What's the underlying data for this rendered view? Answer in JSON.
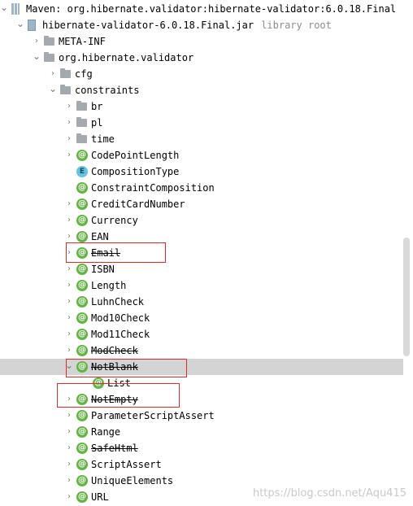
{
  "tree": {
    "rows": [
      {
        "label": "Maven: org.hibernate.validator:hibernate-validator:6.0.18.Final",
        "hint": "",
        "kind": "lib",
        "expanded": true,
        "strike": false,
        "icon": "library-icon"
      },
      {
        "label": "hibernate-validator-6.0.18.Final.jar",
        "hint": "library root",
        "kind": "jar",
        "expanded": true,
        "strike": false,
        "icon": "jar-icon"
      },
      {
        "label": "META-INF",
        "hint": "",
        "kind": "folder",
        "expanded": false,
        "strike": false,
        "icon": "folder-icon"
      },
      {
        "label": "org.hibernate.validator",
        "hint": "",
        "kind": "folder",
        "expanded": true,
        "strike": false,
        "icon": "folder-icon"
      },
      {
        "label": "cfg",
        "hint": "",
        "kind": "folder",
        "expanded": false,
        "strike": false,
        "icon": "folder-icon"
      },
      {
        "label": "constraints",
        "hint": "",
        "kind": "folder",
        "expanded": true,
        "strike": false,
        "icon": "folder-icon"
      },
      {
        "label": "br",
        "hint": "",
        "kind": "folder",
        "expanded": false,
        "strike": false,
        "icon": "folder-icon"
      },
      {
        "label": "pl",
        "hint": "",
        "kind": "folder",
        "expanded": false,
        "strike": false,
        "icon": "folder-icon"
      },
      {
        "label": "time",
        "hint": "",
        "kind": "folder",
        "expanded": false,
        "strike": false,
        "icon": "folder-icon"
      },
      {
        "label": "CodePointLength",
        "hint": "",
        "kind": "annotation",
        "expanded": false,
        "strike": false,
        "icon": "annotation-icon"
      },
      {
        "label": "CompositionType",
        "hint": "",
        "kind": "enum",
        "expanded": null,
        "strike": false,
        "icon": "enum-icon"
      },
      {
        "label": "ConstraintComposition",
        "hint": "",
        "kind": "annotation",
        "expanded": null,
        "strike": false,
        "icon": "annotation-icon"
      },
      {
        "label": "CreditCardNumber",
        "hint": "",
        "kind": "annotation",
        "expanded": false,
        "strike": false,
        "icon": "annotation-icon"
      },
      {
        "label": "Currency",
        "hint": "",
        "kind": "annotation",
        "expanded": false,
        "strike": false,
        "icon": "annotation-icon"
      },
      {
        "label": "EAN",
        "hint": "",
        "kind": "annotation",
        "expanded": false,
        "strike": false,
        "icon": "annotation-icon"
      },
      {
        "label": "Email",
        "hint": "",
        "kind": "annotation",
        "expanded": false,
        "strike": true,
        "icon": "annotation-icon"
      },
      {
        "label": "ISBN",
        "hint": "",
        "kind": "annotation",
        "expanded": false,
        "strike": false,
        "icon": "annotation-icon"
      },
      {
        "label": "Length",
        "hint": "",
        "kind": "annotation",
        "expanded": false,
        "strike": false,
        "icon": "annotation-icon"
      },
      {
        "label": "LuhnCheck",
        "hint": "",
        "kind": "annotation",
        "expanded": false,
        "strike": false,
        "icon": "annotation-icon"
      },
      {
        "label": "Mod10Check",
        "hint": "",
        "kind": "annotation",
        "expanded": false,
        "strike": false,
        "icon": "annotation-icon"
      },
      {
        "label": "Mod11Check",
        "hint": "",
        "kind": "annotation",
        "expanded": false,
        "strike": false,
        "icon": "annotation-icon"
      },
      {
        "label": "ModCheck",
        "hint": "",
        "kind": "annotation",
        "expanded": false,
        "strike": true,
        "icon": "annotation-icon"
      },
      {
        "label": "NotBlank",
        "hint": "",
        "kind": "annotation",
        "expanded": true,
        "strike": true,
        "selected": true,
        "icon": "annotation-icon"
      },
      {
        "label": "List",
        "hint": "",
        "kind": "annotation",
        "expanded": null,
        "strike": false,
        "icon": "annotation-icon"
      },
      {
        "label": "NotEmpty",
        "hint": "",
        "kind": "annotation",
        "expanded": false,
        "strike": true,
        "icon": "annotation-icon"
      },
      {
        "label": "ParameterScriptAssert",
        "hint": "",
        "kind": "annotation",
        "expanded": false,
        "strike": false,
        "icon": "annotation-icon"
      },
      {
        "label": "Range",
        "hint": "",
        "kind": "annotation",
        "expanded": false,
        "strike": false,
        "icon": "annotation-icon"
      },
      {
        "label": "SafeHtml",
        "hint": "",
        "kind": "annotation",
        "expanded": false,
        "strike": true,
        "icon": "annotation-icon"
      },
      {
        "label": "ScriptAssert",
        "hint": "",
        "kind": "annotation",
        "expanded": false,
        "strike": false,
        "icon": "annotation-icon"
      },
      {
        "label": "UniqueElements",
        "hint": "",
        "kind": "annotation",
        "expanded": false,
        "strike": false,
        "icon": "annotation-icon"
      },
      {
        "label": "URL",
        "hint": "",
        "kind": "annotation",
        "expanded": false,
        "strike": false,
        "icon": "annotation-icon"
      }
    ]
  },
  "watermark": "https://blog.csdn.net/Aqu415",
  "colors": {
    "highlight_box": "#e02b2b",
    "selection": "#d4d4d4",
    "annotation": "#62b543",
    "enum": "#66c2e3"
  }
}
